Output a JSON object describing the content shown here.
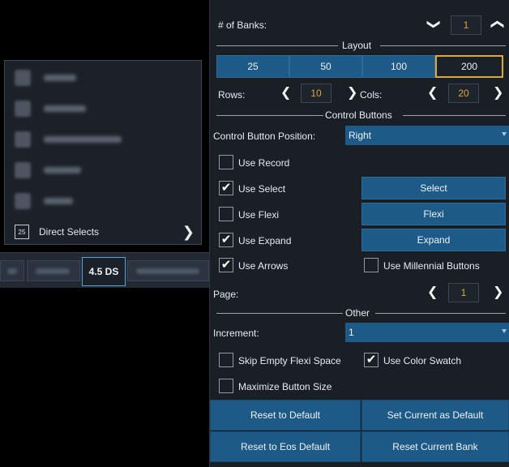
{
  "menu": {
    "direct_selects_icon_text": "25",
    "direct_selects_label": "Direct Selects"
  },
  "tabs": {
    "active_label": "4.5 DS"
  },
  "config": {
    "banks_label": "# of Banks:",
    "banks_value": "1",
    "layout_title": "Layout",
    "layout_options": [
      "25",
      "50",
      "100",
      "200"
    ],
    "layout_selected": "200",
    "rows_label": "Rows:",
    "rows_value": "10",
    "cols_label": "Cols:",
    "cols_value": "20",
    "control_buttons_title": "Control Buttons",
    "position_label": "Control Button Position:",
    "position_value": "Right",
    "use_record_label": "Use Record",
    "use_select_label": "Use Select",
    "use_flexi_label": "Use Flexi",
    "use_expand_label": "Use Expand",
    "use_arrows_label": "Use Arrows",
    "use_millennial_label": "Use Millennial Buttons",
    "select_button": "Select",
    "flexi_button": "Flexi",
    "expand_button": "Expand",
    "page_label": "Page:",
    "page_value": "1",
    "other_title": "Other",
    "increment_label": "Increment:",
    "increment_value": "1",
    "skip_empty_label": "Skip Empty Flexi Space",
    "use_color_swatch_label": "Use Color Swatch",
    "maximize_label": "Maximize Button Size",
    "reset_default": "Reset to Default",
    "set_current_default": "Set Current as Default",
    "reset_eos_default": "Reset to Eos Default",
    "reset_current_bank": "Reset Current Bank"
  },
  "checks": {
    "use_record": false,
    "use_select": true,
    "use_flexi": false,
    "use_expand": true,
    "use_arrows": true,
    "use_millennial": false,
    "skip_empty": false,
    "use_color_swatch": true,
    "maximize": false
  },
  "colors": {
    "accent_blue": "#1d5a88",
    "highlight_orange": "#e0a63a",
    "panel_bg": "#1a1f26"
  }
}
